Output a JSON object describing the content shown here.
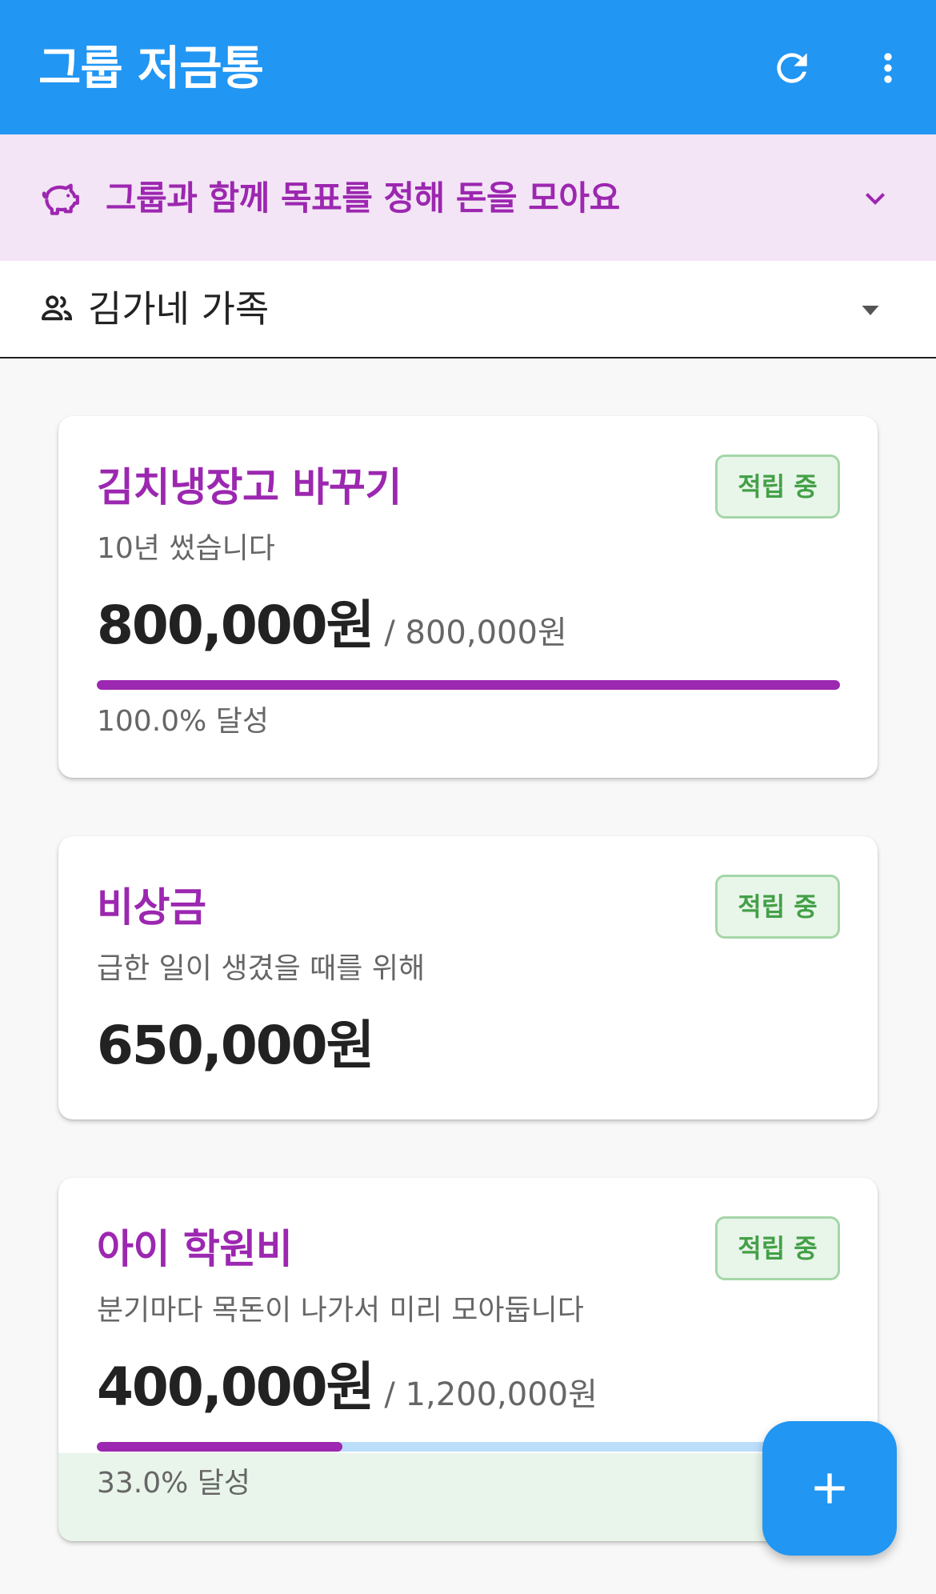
{
  "app_bar": {
    "title": "그룹 저금통",
    "refresh_icon": "refresh-icon",
    "more_icon": "more-vert-icon",
    "color": "#2196f3"
  },
  "banner": {
    "icon": "piggy-bank-icon",
    "text": "그룹과 함께 목표를 정해 돈을 모아요",
    "chevron_icon": "chevron-down-icon",
    "color": "#9c27b0",
    "background": "#f3e5f5"
  },
  "group_selector": {
    "icon": "people-icon",
    "selected": "김가네 가족",
    "caret_icon": "arrow-drop-down-icon"
  },
  "savings": [
    {
      "title": "김치냉장고 바꾸기",
      "description": "10년 썼습니다",
      "amount": "800,000원",
      "target": "/ 800,000원",
      "status": "적립 중",
      "progress": 1.0,
      "progress_label": "100.0% 달성"
    },
    {
      "title": "비상금",
      "description": "급한 일이 생겼을 때를 위해",
      "amount": "650,000원",
      "status": "적립 중"
    },
    {
      "title": "아이 학원비",
      "description": "분기마다 목돈이 나가서 미리 모아둡니다",
      "amount": "400,000원",
      "target": "/ 1,200,000원",
      "status": "적립 중",
      "progress": 0.33,
      "progress_label": "33.0% 달성"
    }
  ],
  "fab": {
    "icon": "add-icon"
  },
  "colors": {
    "accent": "#9c27b0",
    "status_green": "#43a047",
    "progress_track": "#bbdefb"
  }
}
